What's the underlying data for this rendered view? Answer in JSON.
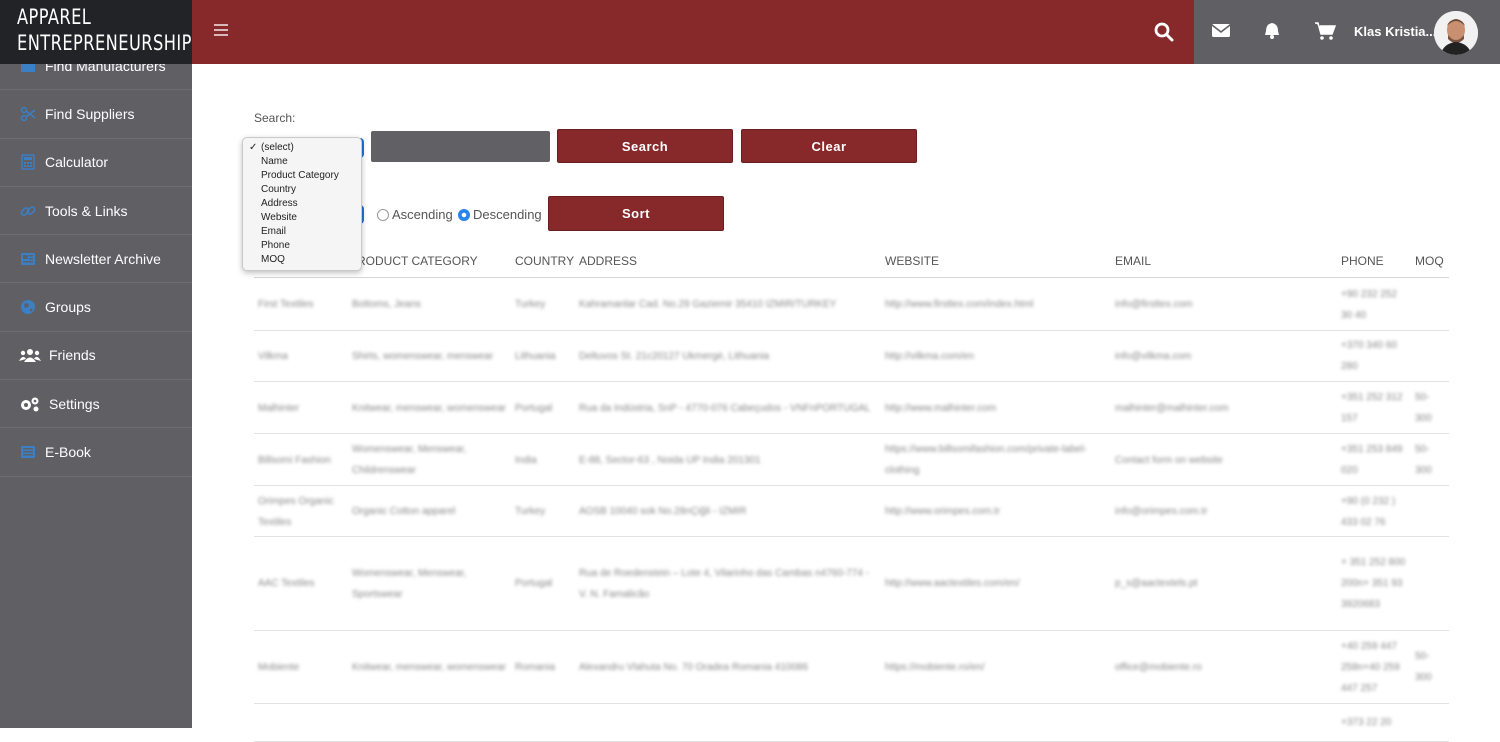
{
  "brand": {
    "line1": "APPAREL",
    "line2": "ENTREPRENEURSHIP"
  },
  "sidebar": {
    "items": [
      {
        "label": "Find Manufacturers",
        "icon": "factory-icon"
      },
      {
        "label": "Find Suppliers",
        "icon": "scissors-icon"
      },
      {
        "label": "Calculator",
        "icon": "calculator-icon"
      },
      {
        "label": "Tools & Links",
        "icon": "link-icon"
      },
      {
        "label": "Newsletter Archive",
        "icon": "newspaper-icon"
      },
      {
        "label": "Groups",
        "icon": "globe-icon"
      },
      {
        "label": "Friends",
        "icon": "users-icon"
      },
      {
        "label": "Settings",
        "icon": "gears-icon"
      },
      {
        "label": "E-Book",
        "icon": "book-icon"
      }
    ]
  },
  "header": {
    "username": "Klas Kristia..."
  },
  "search": {
    "label": "Search:",
    "search_button": "Search",
    "clear_button": "Clear",
    "options": [
      "(select)",
      "Name",
      "Product Category",
      "Country",
      "Address",
      "Website",
      "Email",
      "Phone",
      "MOQ"
    ],
    "selected": "(select)"
  },
  "sort": {
    "ascending": "Ascending",
    "descending": "Descending",
    "selected": "Descending",
    "button": "Sort"
  },
  "table": {
    "columns": [
      "RODUCT CATEGORY",
      "COUNTRY",
      "ADDRESS",
      "WEBSITE",
      "EMAIL",
      "PHONE",
      "MOQ"
    ],
    "rows": [
      {
        "name": "First Textiles",
        "category": "Bottoms, Jeans",
        "country": "Turkey",
        "address": "Kahramanlar Cad. No.29 Gaziemir 35410 IZMIR/TURKEY",
        "website": "http://www.firsttex.com/index.html",
        "email": "info@firsttex.com",
        "phone": "+90 232 252 30 40",
        "moq": ""
      },
      {
        "name": "Vilkma",
        "category": "Shirts, womenswear, menswear",
        "country": "Lithuania",
        "address": "Deltuvos St. 21c20127 Ukmergė, Lithuania",
        "website": "http://vilkma.com/en",
        "email": "info@vilkma.com",
        "phone": "+370 340 60 280",
        "moq": ""
      },
      {
        "name": "Malhinter",
        "category": "Knitwear, menswear, womenswear",
        "country": "Portugal",
        "address": "Rua da Indústria, SnP - 4770-076 Cabeçudos - VNFnPORTUGAL",
        "website": "http://www.malhinter.com",
        "email": "malhinter@malhinter.com",
        "phone": "+351 252 312 157",
        "moq": "50-300"
      },
      {
        "name": "Billsomi Fashion",
        "category": "Womenswear, Menswear, Childrenswear",
        "country": "India",
        "address": "E-88, Sector-63 , Noida UP India 201301",
        "website": "https://www.billsomifashion.com/private-label-clothing",
        "email": "Contact form on website",
        "phone": "+351 253 849 020",
        "moq": "50-300"
      },
      {
        "name": "Orimpes Organic Textiles",
        "category": "Organic Cotton apparel",
        "country": "Turkey",
        "address": "AOSB 10040 sok No.28nÇiğli - IZMIR",
        "website": "http://www.orimpes.com.tr",
        "email": "info@orimpes.com.tr",
        "phone": "+90 (0 232 ) 433 02 76",
        "moq": ""
      },
      {
        "name": "AAC Textiles",
        "category": "Womenswear, Menswear, Sportswear",
        "country": "Portugal",
        "address": "Rua de Roedenstein – Lote 4, Vilarinho das Cambas n4760-774 - V. N. Famalicão",
        "website": "http://www.aactextiles.com/en/",
        "email": "p_s@aactextels.pt",
        "phone": "+ 351 252 800 200n+ 351 93 3920683",
        "moq": ""
      },
      {
        "name": "Mobiente",
        "category": "Knitwear, menswear, womenswear",
        "country": "Romania",
        "address": "Alexandru Vlahuta No. 70 Oradea Romania 410086",
        "website": "https://mobiente.ro/en/",
        "email": "office@mobiente.ro",
        "phone": "+40 259 447 258n+40 259 447 257",
        "moq": "50-300"
      },
      {
        "name": "",
        "category": "",
        "country": "",
        "address": "",
        "website": "",
        "email": "",
        "phone": "+373 22 20",
        "moq": ""
      }
    ]
  },
  "colors": {
    "brand_red": "#87292b",
    "sidebar_gray": "#5f5f64",
    "brand_black": "#222326",
    "radio_blue": "#2b84e8"
  }
}
